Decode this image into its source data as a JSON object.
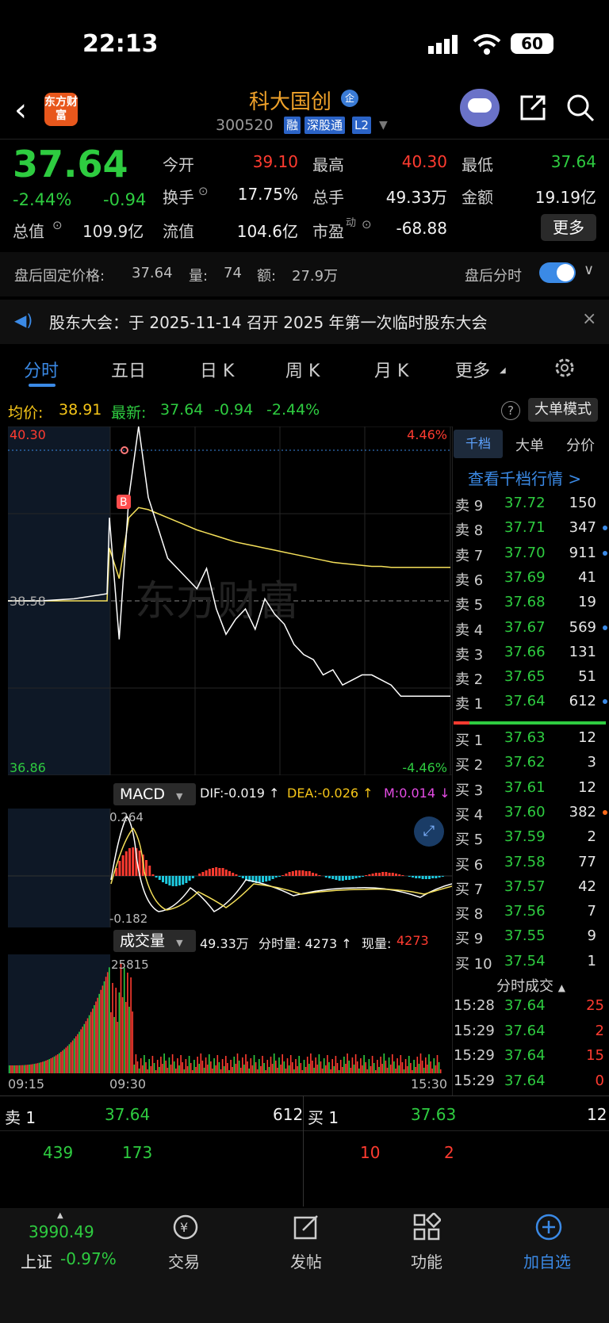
{
  "status_bar": {
    "time": "22:13",
    "battery": "60"
  },
  "header": {
    "logo_text": "东方财富",
    "stock_name": "科大国创",
    "qi_badge": "企",
    "stock_code": "300520",
    "tags": [
      "融",
      "深股通",
      "L2"
    ]
  },
  "quote": {
    "price": "37.64",
    "change_pct": "-2.44%",
    "change": "-0.94",
    "market_cap_label": "总值",
    "market_cap": "109.9亿",
    "fields": [
      {
        "label": "今开",
        "value": "39.10",
        "color": "#ff3b30"
      },
      {
        "label": "最高",
        "value": "40.30",
        "color": "#ff3b30"
      },
      {
        "label": "最低",
        "value": "37.64",
        "color": "#2ecc40"
      },
      {
        "label": "换手",
        "value": "17.75%",
        "color": "#e6e6e6"
      },
      {
        "label": "总手",
        "value": "49.33万",
        "color": "#e6e6e6"
      },
      {
        "label": "金额",
        "value": "19.19亿",
        "color": "#e6e6e6"
      },
      {
        "label": "流值",
        "value": "104.6亿",
        "color": "#e6e6e6"
      },
      {
        "label": "市盈",
        "value": "-68.88",
        "color": "#e6e6e6"
      }
    ],
    "pe_suffix": "动",
    "more_label": "更多"
  },
  "after_hours": {
    "label": "盘后固定价格:",
    "price": "37.64",
    "vol_label": "量:",
    "vol": "74",
    "amt_label": "额:",
    "amt": "27.9万",
    "toggle_label": "盘后分时",
    "toggle_on": true
  },
  "notice": {
    "text": "股东大会：于 2025-11-14 召开 2025 年第一次临时股东大会"
  },
  "tabs": [
    "分时",
    "五日",
    "日 K",
    "周 K",
    "月 K",
    "更多"
  ],
  "avg_row": {
    "avg_label": "均价:",
    "avg_value": "38.91",
    "latest_label": "最新:",
    "latest_value": "37.64",
    "latest_change": "-0.94",
    "latest_pct": "-2.44%",
    "help": "?",
    "big_order_mode": "大单模式"
  },
  "chart_data": {
    "type": "line",
    "title": "",
    "price_axis": {
      "top": "40.30",
      "mid": "38.58",
      "bottom": "36.86"
    },
    "pct_axis": {
      "top": "4.46%",
      "bottom": "-4.46%"
    },
    "time_axis": [
      "09:15",
      "09:30",
      "15:30"
    ],
    "watermark": "东方财富",
    "buy_marker": "B",
    "series": [
      {
        "name": "price",
        "color": "#ffffff",
        "values": [
          38.58,
          38.58,
          38.6,
          38.65,
          39.4,
          38.2,
          39.6,
          40.3,
          39.6,
          39.3,
          39.0,
          38.9,
          38.8,
          38.7,
          38.9,
          38.5,
          38.25,
          38.4,
          38.5,
          38.3,
          38.6,
          38.45,
          38.35,
          38.15,
          38.05,
          38.0,
          37.85,
          37.9,
          37.75,
          37.8,
          37.85,
          37.85,
          37.8,
          37.75,
          37.64,
          37.64,
          37.64
        ]
      },
      {
        "name": "avg",
        "color": "#f5e05a",
        "values": [
          38.58,
          38.58,
          38.58,
          38.58,
          39.1,
          38.8,
          39.4,
          39.5,
          39.48,
          39.44,
          39.4,
          39.36,
          39.32,
          39.28,
          39.25,
          39.22,
          39.19,
          39.16,
          39.14,
          39.12,
          39.1,
          39.08,
          39.06,
          39.04,
          39.02,
          39.0,
          38.98,
          38.96,
          38.95,
          38.94,
          38.93,
          38.92,
          38.92,
          38.91,
          38.91,
          38.91,
          38.91
        ]
      }
    ]
  },
  "macd": {
    "label": "MACD",
    "dif": "DIF:-0.019 ↑",
    "dea": "DEA:-0.026 ↑",
    "m": "M:0.014 ↓",
    "top": "0.264",
    "bottom": "-0.182"
  },
  "volume": {
    "label": "成交量",
    "total": "49.33万",
    "period": "分时量: 4273 ↑",
    "current_label": "现量:",
    "current": "4273",
    "max": "25815"
  },
  "right_panel": {
    "tabs": [
      "千档",
      "大单",
      "分价"
    ],
    "view_link": "查看千档行情 >",
    "asks": [
      {
        "label": "卖 9",
        "price": "37.72",
        "vol": "150",
        "dot": ""
      },
      {
        "label": "卖 8",
        "price": "37.71",
        "vol": "347",
        "dot": "#3b8ae6"
      },
      {
        "label": "卖 7",
        "price": "37.70",
        "vol": "911",
        "dot": "#3b8ae6"
      },
      {
        "label": "卖 6",
        "price": "37.69",
        "vol": "41",
        "dot": ""
      },
      {
        "label": "卖 5",
        "price": "37.68",
        "vol": "19",
        "dot": ""
      },
      {
        "label": "卖 4",
        "price": "37.67",
        "vol": "569",
        "dot": "#3b8ae6"
      },
      {
        "label": "卖 3",
        "price": "37.66",
        "vol": "131",
        "dot": ""
      },
      {
        "label": "卖 2",
        "price": "37.65",
        "vol": "51",
        "dot": ""
      },
      {
        "label": "卖 1",
        "price": "37.64",
        "vol": "612",
        "dot": "#3b8ae6"
      }
    ],
    "bids": [
      {
        "label": "买 1",
        "price": "37.63",
        "vol": "12",
        "dot": ""
      },
      {
        "label": "买 2",
        "price": "37.62",
        "vol": "3",
        "dot": ""
      },
      {
        "label": "买 3",
        "price": "37.61",
        "vol": "12",
        "dot": ""
      },
      {
        "label": "买 4",
        "price": "37.60",
        "vol": "382",
        "dot": "#ff6a1a"
      },
      {
        "label": "买 5",
        "price": "37.59",
        "vol": "2",
        "dot": ""
      },
      {
        "label": "买 6",
        "price": "37.58",
        "vol": "77",
        "dot": ""
      },
      {
        "label": "买 7",
        "price": "37.57",
        "vol": "42",
        "dot": ""
      },
      {
        "label": "买 8",
        "price": "37.56",
        "vol": "7",
        "dot": ""
      },
      {
        "label": "买 9",
        "price": "37.55",
        "vol": "9",
        "dot": ""
      },
      {
        "label": "买 10",
        "price": "37.54",
        "vol": "1",
        "dot": ""
      }
    ],
    "ticks_header": "分时成交",
    "ticks": [
      {
        "time": "15:28",
        "price": "37.64",
        "vol": "25"
      },
      {
        "time": "15:29",
        "price": "37.64",
        "vol": "2"
      },
      {
        "time": "15:29",
        "price": "37.64",
        "vol": "15"
      },
      {
        "time": "15:29",
        "price": "37.64",
        "vol": "0"
      }
    ]
  },
  "bottom_quote": {
    "ask_label": "卖 1",
    "ask_price": "37.64",
    "ask_vol": "612",
    "bid_label": "买 1",
    "bid_price": "37.63",
    "bid_vol": "12",
    "row2": [
      "439",
      "173",
      "10",
      "2"
    ]
  },
  "nav": {
    "index_value": "3990.49",
    "index_name": "上证",
    "index_pct": "-0.97%",
    "items": [
      "交易",
      "发帖",
      "功能",
      "加自选"
    ]
  },
  "colors": {
    "up": "#ff3b30",
    "down": "#2ecc40",
    "accent": "#3b8ae6"
  }
}
